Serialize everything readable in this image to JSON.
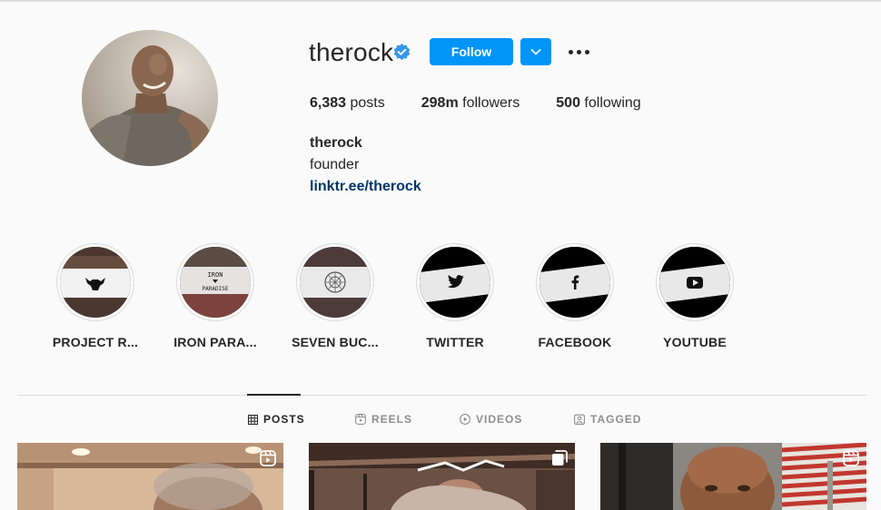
{
  "profile": {
    "username": "therock",
    "follow_label": "Follow",
    "full_name": "therock",
    "bio": "founder",
    "link": "linktr.ee/therock"
  },
  "stats": {
    "posts_count": "6,383",
    "posts_label": "posts",
    "followers_count": "298m",
    "followers_label": "followers",
    "following_count": "500",
    "following_label": "following"
  },
  "highlights": [
    {
      "label": "PROJECT R...",
      "icon": "bull-logo-icon"
    },
    {
      "label": "IRON PARA...",
      "icon": "iron-paradise-logo-icon"
    },
    {
      "label": "SEVEN BUC...",
      "icon": "seven-bucks-logo-icon"
    },
    {
      "label": "TWITTER",
      "icon": "twitter-icon"
    },
    {
      "label": "FACEBOOK",
      "icon": "facebook-icon"
    },
    {
      "label": "YOUTUBE",
      "icon": "youtube-icon"
    }
  ],
  "iron_paradise_text": {
    "line1": "IRON",
    "line2": "PARADISE"
  },
  "tabs": [
    {
      "label": "POSTS",
      "icon": "grid-icon",
      "active": true
    },
    {
      "label": "REELS",
      "icon": "reels-icon",
      "active": false
    },
    {
      "label": "VIDEOS",
      "icon": "play-icon",
      "active": false
    },
    {
      "label": "TAGGED",
      "icon": "tagged-icon",
      "active": false
    }
  ],
  "posts": [
    {
      "type_icon": "reel-icon"
    },
    {
      "type_icon": "multiple-icon"
    },
    {
      "type_icon": "reel-icon"
    }
  ],
  "colors": {
    "accent": "#0095f6",
    "verified": "#3897f0",
    "link": "#00376b",
    "text": "#262626",
    "muted": "#8e8e8e",
    "background": "#fafafa"
  }
}
